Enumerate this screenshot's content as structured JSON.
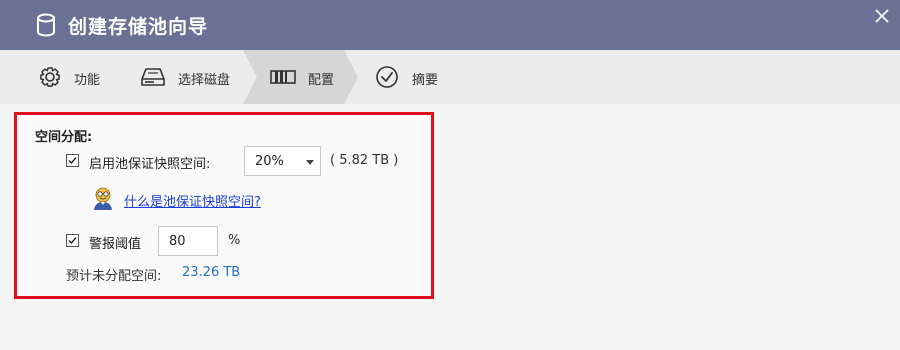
{
  "window": {
    "title": "创建存储池向导"
  },
  "steps": [
    {
      "label": "功能",
      "icon": "gear-icon"
    },
    {
      "label": "选择磁盘",
      "icon": "hard-drive-icon"
    },
    {
      "label": "配置",
      "icon": "raid-config-icon",
      "active": true
    },
    {
      "label": "摘要",
      "icon": "check-circle-icon"
    }
  ],
  "config": {
    "section_title": "空间分配:",
    "snapshot_reserve": {
      "checked": true,
      "label": "启用池保证快照空间:",
      "selected": "20%",
      "capacity": "( 5.82 TB )",
      "help_link": "什么是池保证快照空间?"
    },
    "alert_threshold": {
      "checked": true,
      "label": "警报阈值",
      "value": "80",
      "unit": "%"
    },
    "unallocated": {
      "label": "预计未分配空间:",
      "value": "23.26 TB"
    }
  },
  "colors": {
    "titlebar": "#6b7194",
    "highlight_border": "#e3101f",
    "link": "#1a3fd8",
    "value": "#1f6fc4"
  }
}
